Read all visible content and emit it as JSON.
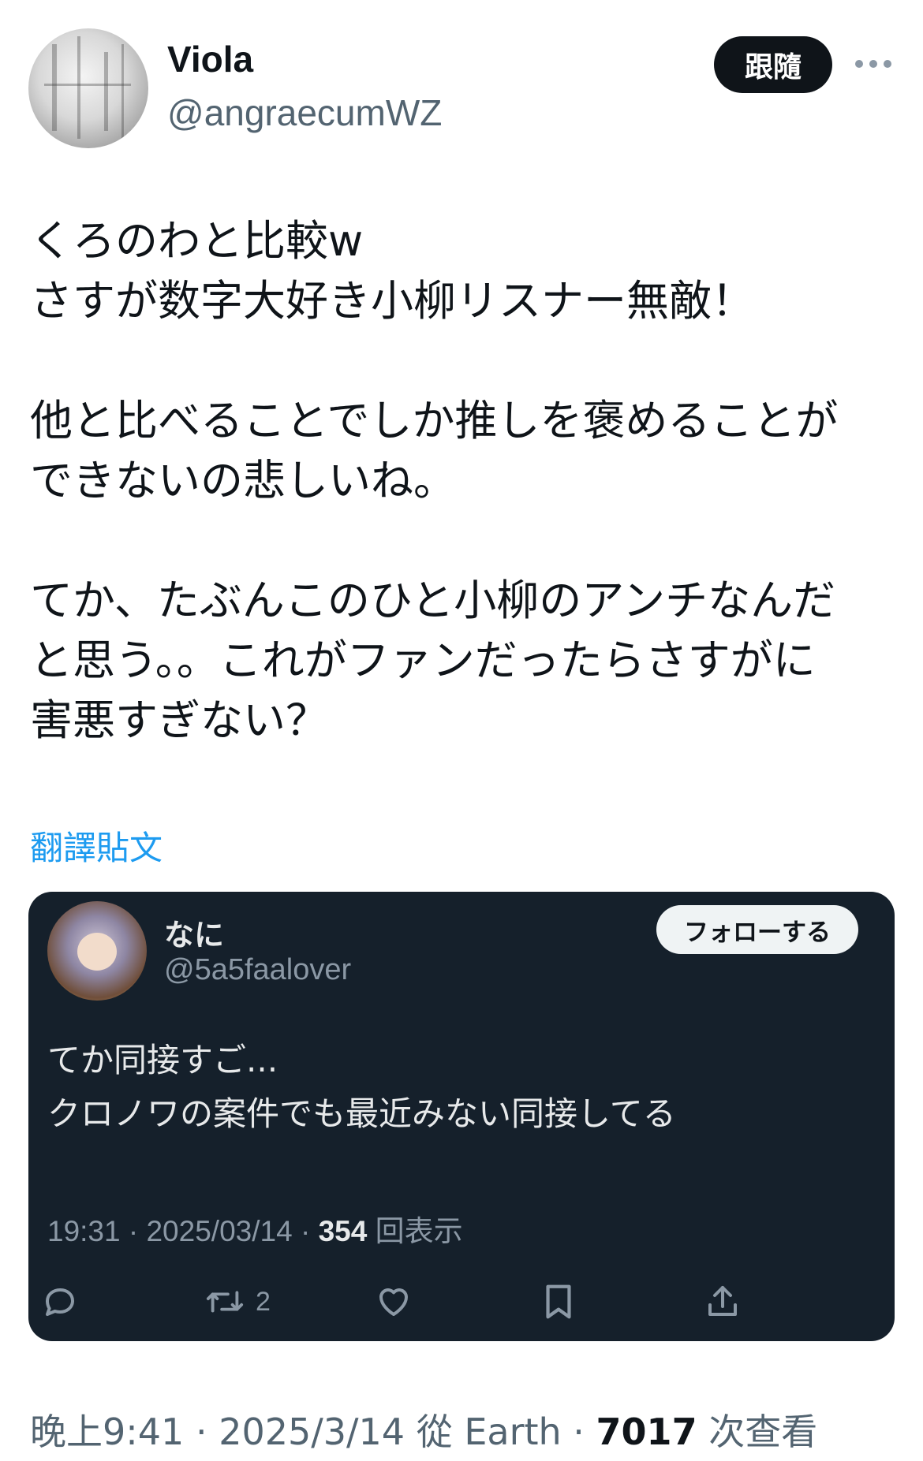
{
  "author": {
    "display_name": "Viola",
    "handle": "@angraecumWZ",
    "follow_label": "跟隨"
  },
  "tweet": {
    "lines": [
      "くろのわと比較w",
      "さすが数字大好き小柳リスナー無敵！",
      "",
      "他と比べることでしか推しを褒めることが",
      "できないの悲しいね。",
      "",
      "てか、たぶんこのひと小柳のアンチなんだ",
      "と思う。。これがファンだったらさすがに",
      "害悪すぎない？"
    ],
    "translate_label": "翻譯貼文"
  },
  "quote": {
    "display_name": "なに",
    "handle": "@5a5faalover",
    "follow_label": "フォローする",
    "lines": [
      "てか同接すご...",
      "クロノワの案件でも最近みない同接してる"
    ],
    "time": "19:31",
    "date": "2025/03/14",
    "views": "354",
    "views_label": "回表示",
    "retweet_count": "2"
  },
  "footer": {
    "time": "晚上9:41",
    "date": "2025/3/14",
    "source_prefix": "從",
    "source": "Earth",
    "views": "7017",
    "views_label": "次查看"
  },
  "colors": {
    "link": "#1d9bf0",
    "quote_bg": "#15202b",
    "primary_text": "#0f1419",
    "secondary_text": "#536471"
  }
}
